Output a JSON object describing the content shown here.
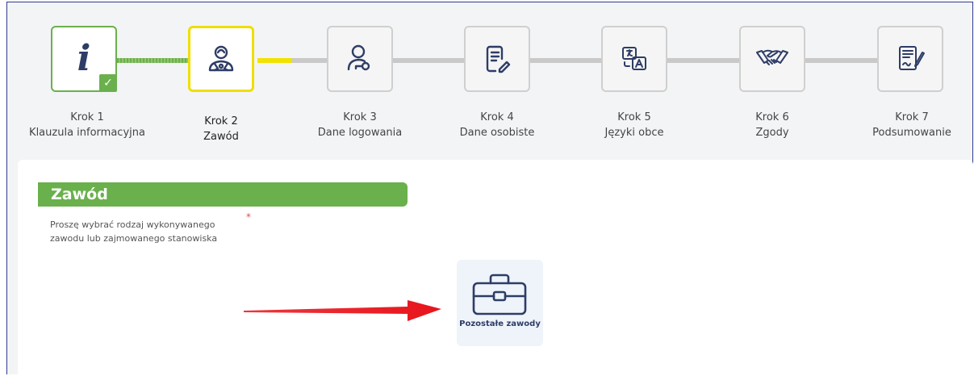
{
  "steps": [
    {
      "title": "Krok 1",
      "name": "Klauzula informacyjna",
      "state": "done",
      "icon": "info-icon"
    },
    {
      "title": "Krok 2",
      "name": "Zawód",
      "state": "active",
      "icon": "worker-icon"
    },
    {
      "title": "Krok 3",
      "name": "Dane logowania",
      "state": "pending",
      "icon": "user-key-icon"
    },
    {
      "title": "Krok 4",
      "name": "Dane osobiste",
      "state": "pending",
      "icon": "document-edit-icon"
    },
    {
      "title": "Krok 5",
      "name": "Języki obce",
      "state": "pending",
      "icon": "translate-icon"
    },
    {
      "title": "Krok 6",
      "name": "Zgody",
      "state": "pending",
      "icon": "handshake-icon"
    },
    {
      "title": "Krok 7",
      "name": "Podsumowanie",
      "state": "pending",
      "icon": "contract-sign-icon"
    }
  ],
  "step1_letter": "i",
  "check_mark": "✓",
  "section": {
    "title": "Zawód",
    "prompt": "Proszę wybrać rodzaj wykonywanego zawodu lub zajmowanego stanowiska",
    "required_marker": "*"
  },
  "options": [
    {
      "label": "Pozostałe zawody",
      "icon": "briefcase-icon"
    }
  ],
  "colors": {
    "accent_green": "#6ab04c",
    "active_yellow": "#f0de00",
    "icon_navy": "#2e3d66",
    "arrow_red": "#e8141b"
  }
}
